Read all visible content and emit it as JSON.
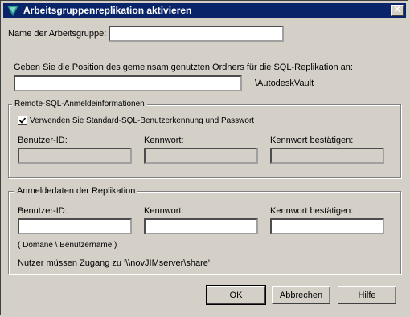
{
  "window": {
    "title": "Arbeitsgruppenreplikation aktivieren",
    "close_glyph": "✕"
  },
  "workgroup": {
    "label": "Name der Arbeitsgruppe:",
    "value": ""
  },
  "shared_folder": {
    "label": "Geben Sie die Position des gemeinsam genutzten Ordners für die SQL-Replikation an:",
    "value": "",
    "suffix": "\\AutodeskVault"
  },
  "remote_sql": {
    "group_title": "Remote-SQL-Anmeldeinformationen",
    "use_default_label": "Verwenden Sie Standard-SQL-Benutzerkennung und Passwort",
    "use_default_checked": true,
    "user_id_label": "Benutzer-ID:",
    "password_label": "Kennwort:",
    "confirm_label": "Kennwort bestätigen:"
  },
  "replication": {
    "group_title": "Anmeldedaten der Replikation",
    "user_id_label": "Benutzer-ID:",
    "password_label": "Kennwort:",
    "confirm_label": "Kennwort bestätigen:",
    "hint": "( Domäne \\ Benutzername )",
    "access_note": "Nutzer müssen Zugang zu '\\\\novJIMserver\\share'."
  },
  "buttons": {
    "ok": "OK",
    "cancel": "Abbrechen",
    "help": "Hilfe"
  },
  "colors": {
    "titlebar": "#0a246a",
    "face": "#d4d0c8"
  }
}
